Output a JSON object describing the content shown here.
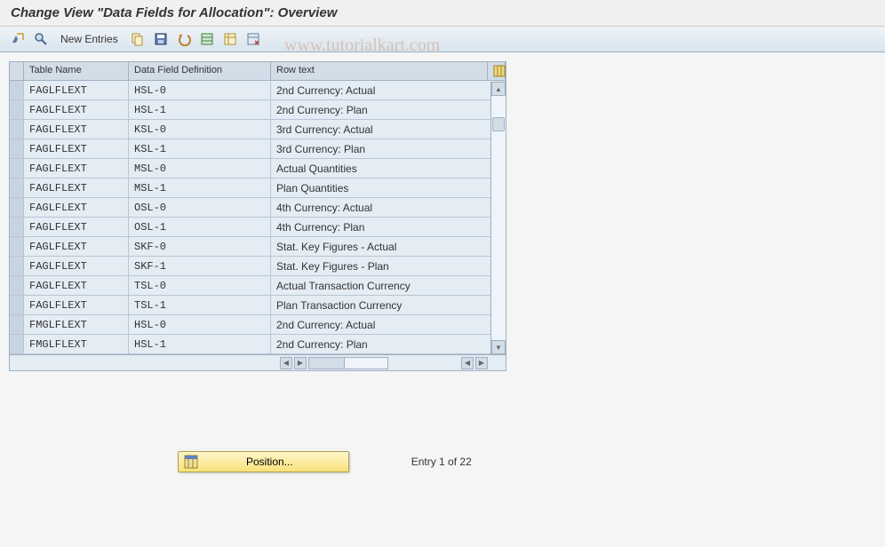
{
  "window": {
    "title": "Change View \"Data Fields for Allocation\": Overview"
  },
  "toolbar": {
    "new_entries_label": "New Entries"
  },
  "watermark": "www.tutorialkart.com",
  "table": {
    "headers": {
      "table_name": "Table Name",
      "data_field_def": "Data Field Definition",
      "row_text": "Row text"
    },
    "rows": [
      {
        "table": "FAGLFLEXT",
        "def": "HSL-0",
        "text": "2nd Currency: Actual"
      },
      {
        "table": "FAGLFLEXT",
        "def": "HSL-1",
        "text": "2nd Currency: Plan"
      },
      {
        "table": "FAGLFLEXT",
        "def": "KSL-0",
        "text": "3rd Currency: Actual"
      },
      {
        "table": "FAGLFLEXT",
        "def": "KSL-1",
        "text": "3rd Currency: Plan"
      },
      {
        "table": "FAGLFLEXT",
        "def": "MSL-0",
        "text": "Actual Quantities"
      },
      {
        "table": "FAGLFLEXT",
        "def": "MSL-1",
        "text": "Plan Quantities"
      },
      {
        "table": "FAGLFLEXT",
        "def": "OSL-0",
        "text": "4th Currency: Actual"
      },
      {
        "table": "FAGLFLEXT",
        "def": "OSL-1",
        "text": "4th Currency: Plan"
      },
      {
        "table": "FAGLFLEXT",
        "def": "SKF-0",
        "text": "Stat. Key Figures - Actual"
      },
      {
        "table": "FAGLFLEXT",
        "def": "SKF-1",
        "text": "Stat. Key Figures - Plan"
      },
      {
        "table": "FAGLFLEXT",
        "def": "TSL-0",
        "text": "Actual Transaction Currency"
      },
      {
        "table": "FAGLFLEXT",
        "def": "TSL-1",
        "text": "Plan Transaction Currency"
      },
      {
        "table": "FMGLFLEXT",
        "def": "HSL-0",
        "text": "2nd Currency: Actual"
      },
      {
        "table": "FMGLFLEXT",
        "def": "HSL-1",
        "text": "2nd Currency: Plan"
      }
    ]
  },
  "footer": {
    "position_label": "Position...",
    "entry_info": "Entry 1 of 22"
  }
}
